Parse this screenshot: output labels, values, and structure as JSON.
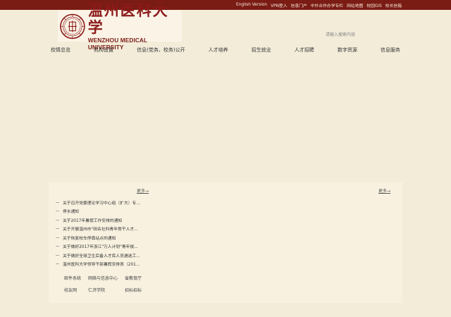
{
  "topbar": {
    "links": [
      "English Version",
      "VPN登入",
      "信息门户",
      "中外合作办学专栏",
      "网站地图",
      "校园GIS",
      "校长信箱"
    ]
  },
  "logo": {
    "name_cn": "温州医科大学",
    "name_en": "WENZHOU MEDICAL UNIVERSITY"
  },
  "search": {
    "placeholder": "请输入搜索内容"
  },
  "nav": {
    "items": [
      "校情总览",
      "机构设置",
      "信息(党务、校务)公开",
      "人才培养",
      "招生就业",
      "人才招聘",
      "数字资源",
      "信息服务"
    ]
  },
  "content": {
    "more_left": "更多→",
    "more_right": "更多→",
    "news": [
      "关于召开党委理论学习中心组（扩大）专...",
      "停水通知",
      "关于2017年暑假工作安排的通知",
      "关于开展温州市\"田名社科青年骨干人才...",
      "关于恢复校车停靠站点的通知",
      "关于做好2017年浙江\"万人计划\"青年拔...",
      "关于做好全球卫生后备人才库人员遴选工...",
      "温州医科大学领导干部暑假安排表（201..."
    ],
    "links": [
      "邮件系统",
      "网络与信息中心",
      "省教育厅",
      "校友网",
      "仁济学院",
      "招标招标"
    ]
  },
  "colors": {
    "topbar": "#7a1b14",
    "background": "#f3ecd9",
    "panel": "#f8f1e0",
    "brand": "#8b1a1a"
  }
}
